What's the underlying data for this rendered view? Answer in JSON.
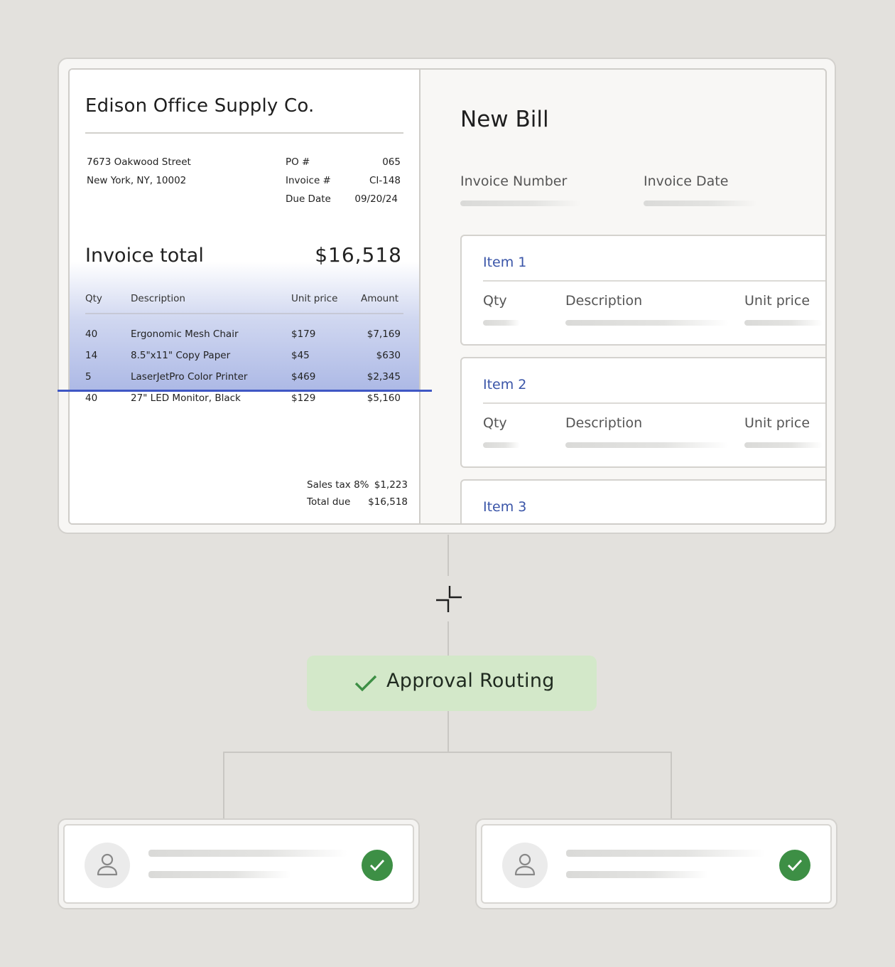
{
  "invoice": {
    "company": "Edison Office Supply Co.",
    "address": [
      "7673 Oakwood Street",
      "New York, NY, 10002"
    ],
    "meta": [
      {
        "label": "PO #",
        "value": "065"
      },
      {
        "label": "Invoice #",
        "value": "CI-148"
      },
      {
        "label": "Due Date",
        "value": "09/20/24"
      }
    ],
    "total_label": "Invoice total",
    "total_value": "$16,518",
    "columns": [
      "Qty",
      "Description",
      "Unit price",
      "Amount"
    ],
    "rows": [
      {
        "qty": "40",
        "description": "Ergonomic Mesh Chair",
        "unit_price": "$179",
        "amount": "$7,169"
      },
      {
        "qty": "14",
        "description": "8.5\"x11\" Copy Paper",
        "unit_price": "$45",
        "amount": "$630"
      },
      {
        "qty": "5",
        "description": "LaserJetPro Color Printer",
        "unit_price": "$469",
        "amount": "$2,345"
      },
      {
        "qty": "40",
        "description": "27\" LED Monitor, Black",
        "unit_price": "$129",
        "amount": "$5,160"
      }
    ],
    "sales_tax_label": "Sales tax 8%",
    "sales_tax_value": "$1,223",
    "total_due_label": "Total due",
    "total_due_value": "$16,518"
  },
  "bill": {
    "title": "New Bill",
    "fields": [
      "Invoice Number",
      "Invoice Date"
    ],
    "items": [
      {
        "title": "Item 1",
        "columns": [
          "Qty",
          "Description",
          "Unit price"
        ]
      },
      {
        "title": "Item 2",
        "columns": [
          "Qty",
          "Description",
          "Unit price"
        ]
      },
      {
        "title": "Item 3"
      }
    ]
  },
  "workflow": {
    "step_label": "Approval Routing",
    "step_icon": "check-icon",
    "approvers": [
      {
        "icon": "user-icon",
        "status_icon": "check-circle-icon"
      },
      {
        "icon": "user-icon",
        "status_icon": "check-circle-icon"
      }
    ]
  },
  "colors": {
    "accent_blue": "#3f57c4",
    "approval_bg": "#d3e8c9",
    "approved_green": "#3d8f45",
    "item_title": "#3a55a8"
  }
}
